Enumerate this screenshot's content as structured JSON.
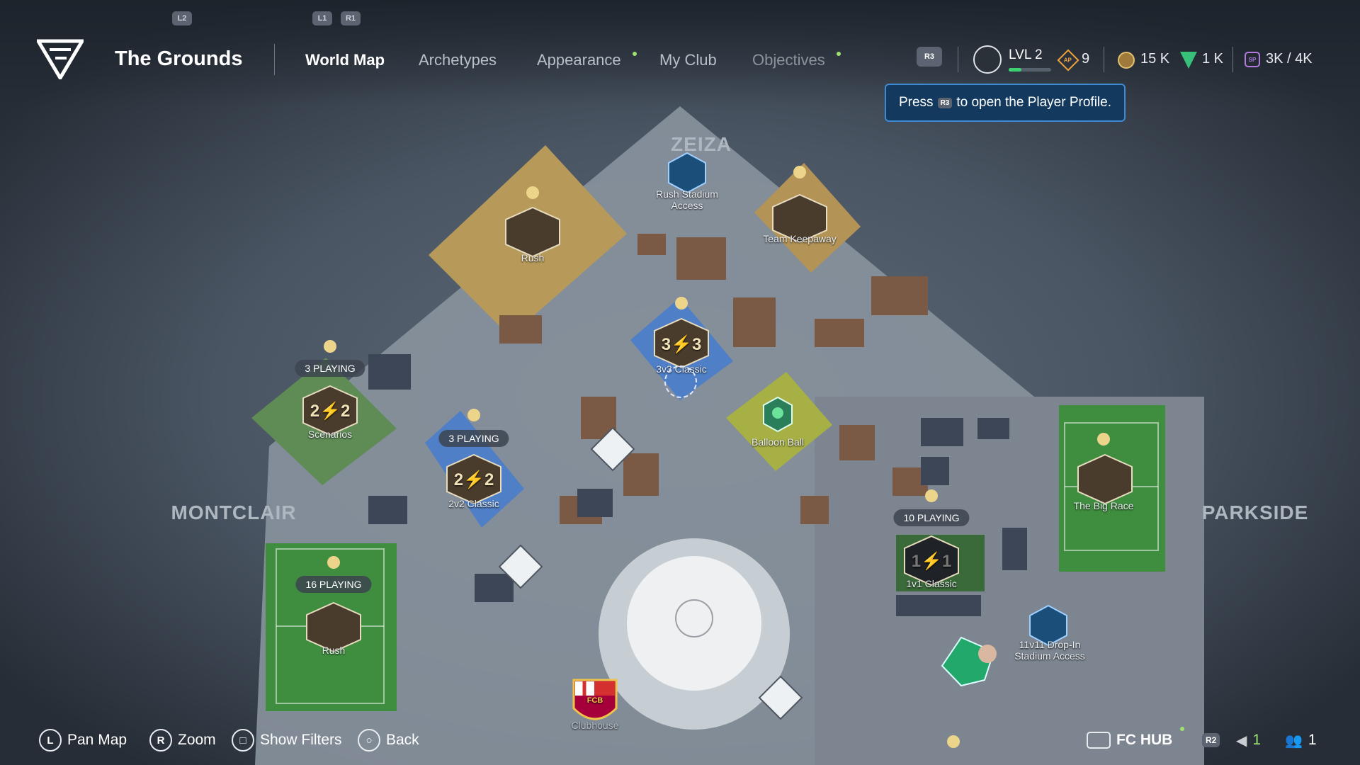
{
  "header": {
    "title": "The Grounds",
    "top_buttons": [
      "L2",
      "L1",
      "R1"
    ],
    "tabs": [
      {
        "label": "World Map",
        "active": true
      },
      {
        "label": "Archetypes"
      },
      {
        "label": "Appearance"
      },
      {
        "label": "My Club"
      },
      {
        "label": "Objectives"
      }
    ],
    "r3_label": "R3",
    "level": "LVL 2",
    "ap_badge": "AP",
    "sp_badge": "SP",
    "ap_value": "9",
    "coins": "15 K",
    "points": "1 K",
    "sp": "3K / 4K"
  },
  "tooltip": {
    "prefix": "Press",
    "button": "R3",
    "suffix": "to open the Player Profile."
  },
  "regions": {
    "north": "ZEIZA",
    "west": "MONTCLAIR",
    "east": "PARKSIDE"
  },
  "pins": {
    "rush_top": "Rush",
    "rush_stadium": "Rush Stadium Access",
    "team_keepaway": "Team Keepaway",
    "three_v_three": "3v3 Classic",
    "three_v_three_icon": "3⚡3",
    "scenarios": "Scenarios",
    "scenarios_icon": "2⚡2",
    "scenarios_playing": "3 PLAYING",
    "two_v_two": "2v2 Classic",
    "two_v_two_icon": "2⚡2",
    "two_v_two_playing": "3 PLAYING",
    "balloon_ball": "Balloon Ball",
    "big_race": "The Big Race",
    "one_v_one": "1v1 Classic",
    "one_v_one_icon": "1⚡1",
    "one_v_one_playing": "10 PLAYING",
    "rush_bottom": "Rush",
    "rush_bottom_playing": "16 PLAYING",
    "drop_in": "11v11 Drop-In Stadium Access",
    "clubhouse": "Clubhouse",
    "crest_text": "FCB"
  },
  "bottom_bar": {
    "pan": {
      "glyph": "L",
      "label": "Pan Map"
    },
    "zoom": {
      "glyph": "R",
      "label": "Zoom"
    },
    "filters": {
      "glyph": "□",
      "label": "Show Filters"
    },
    "back": {
      "glyph": "○",
      "label": "Back"
    },
    "fc_hub": "FC HUB",
    "r2_label": "R2",
    "voice_count": "1",
    "party_count": "1"
  },
  "colors": {
    "accent_green": "#9fe070",
    "tooltip_bg": "#133a5e",
    "tooltip_border": "#3f8ad2"
  }
}
